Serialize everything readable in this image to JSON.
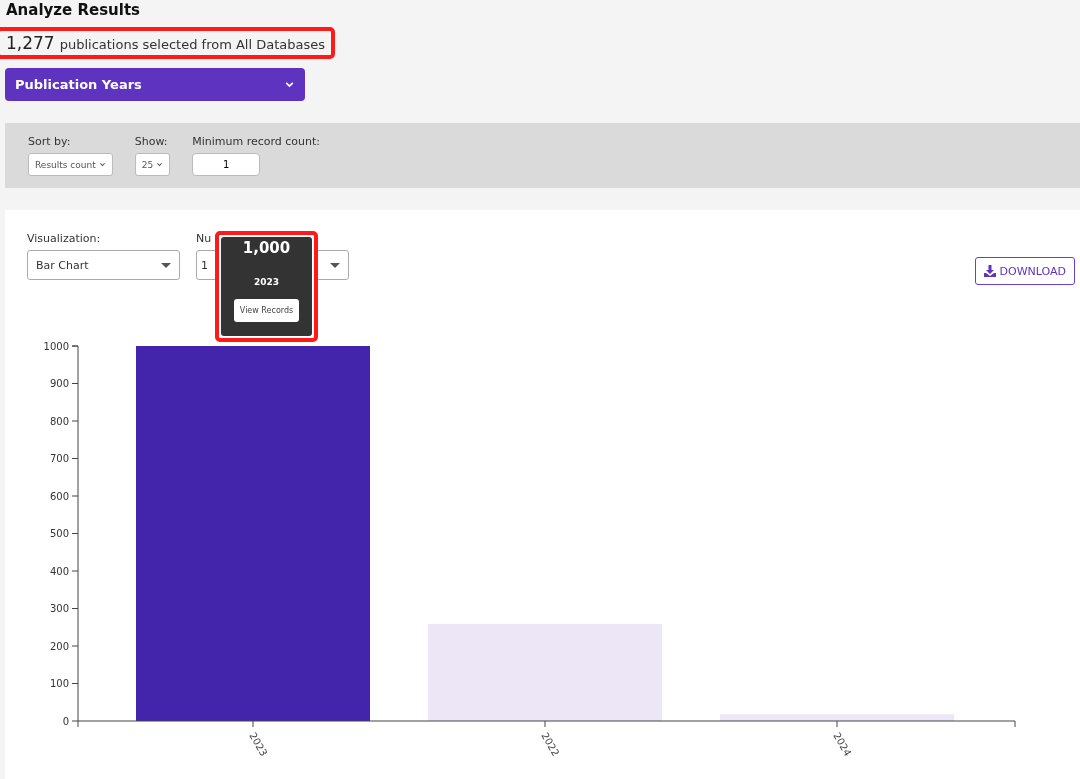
{
  "title": "Analyze Results",
  "summary": {
    "count": "1,277",
    "text": "publications selected from All Databases",
    "highlighted": true
  },
  "field_selector": {
    "label": "Publication Years",
    "expanded": false
  },
  "filters": [
    {
      "kind": "select",
      "label": "Sort by:",
      "value": "Results count"
    },
    {
      "kind": "select",
      "label": "Show:",
      "value": "25"
    },
    {
      "kind": "input",
      "label": "Minimum record count:",
      "value": "1"
    }
  ],
  "visualization": {
    "label": "Visualization:",
    "value": "Bar Chart"
  },
  "results_select": {
    "label": "Nu",
    "value": "1"
  },
  "download_button": "DOWNLOAD",
  "tooltip": {
    "value": "1,000",
    "category": "2023",
    "button": "View Records",
    "highlighted": true
  },
  "bars": [
    {
      "color": "#4225ab"
    },
    {
      "color": "#ece6f6"
    },
    {
      "color": "#ece6f6"
    }
  ],
  "chart_data": {
    "type": "bar",
    "categories": [
      "2023",
      "2022",
      "2024"
    ],
    "series": [
      {
        "values": [
          1000,
          259,
          18
        ]
      }
    ],
    "ylim": [
      0,
      1000
    ],
    "yticks": [
      0,
      100,
      200,
      300,
      400,
      500,
      600,
      700,
      800,
      900,
      1000
    ]
  }
}
